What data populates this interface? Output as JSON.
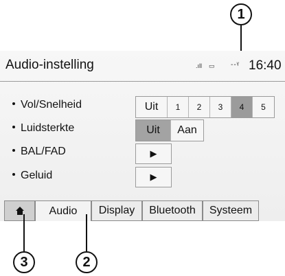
{
  "header": {
    "title": "Audio-instelling",
    "signal": ".ıll",
    "battery": "▭",
    "network": "--ᵞ",
    "time": "16:40"
  },
  "rows": [
    {
      "label": "Vol/Snelheid"
    },
    {
      "label": "Luidsterkte"
    },
    {
      "label": "BAL/FAD"
    },
    {
      "label": "Geluid"
    }
  ],
  "vol_speed": {
    "options": [
      "Uit",
      "1",
      "2",
      "3",
      "4",
      "5"
    ],
    "selected": "4"
  },
  "loudness": {
    "options": [
      "Uit",
      "Aan"
    ],
    "selected": "Uit"
  },
  "arrow_glyph": "▶",
  "tabs": {
    "home_icon": "home-icon",
    "audio": "Audio",
    "display": "Display",
    "bluetooth": "Bluetooth",
    "system": "Systeem"
  },
  "callouts": {
    "c1": "1",
    "c2": "2",
    "c3": "3"
  }
}
